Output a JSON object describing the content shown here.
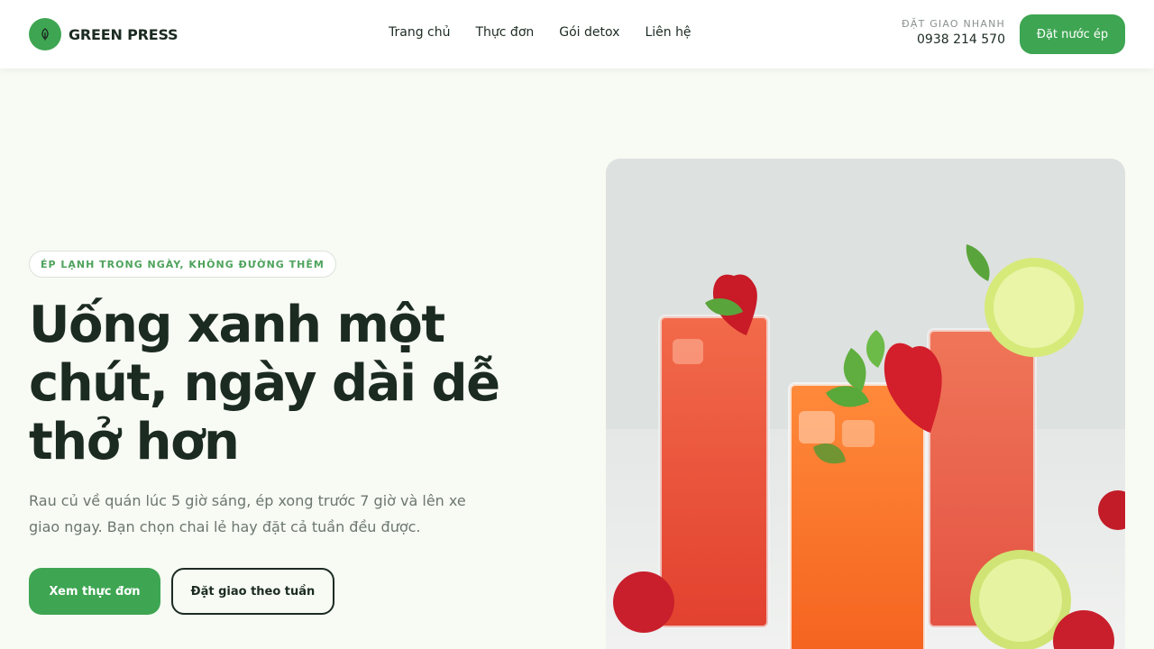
{
  "header": {
    "brand": "GREEN PRESS",
    "logo_icon": "leaf-icon",
    "nav": [
      "Trang chủ",
      "Thực đơn",
      "Gói detox",
      "Liên hệ"
    ],
    "quick_order_label": "ĐẶT GIAO NHANH",
    "quick_order_phone": "0938 214 570",
    "order_button": "Đặt nước ép"
  },
  "hero": {
    "badge": "ÉP LẠNH TRONG NGÀY, KHÔNG ĐƯỜNG THÊM",
    "headline": "Uống xanh một chút, ngày dài dễ thở hơn",
    "description": "Rau củ về quán lúc 5 giờ sáng, ép xong trước 7 giờ và lên xe giao ngay. Bạn chọn chai lẻ hay đặt cả tuần đều được.",
    "primary_button": "Xem thực đơn",
    "secondary_button": "Đặt giao theo tuần"
  },
  "colors": {
    "accent": "#3ea552",
    "background": "#f7fbf3",
    "text": "#1c2b22"
  }
}
